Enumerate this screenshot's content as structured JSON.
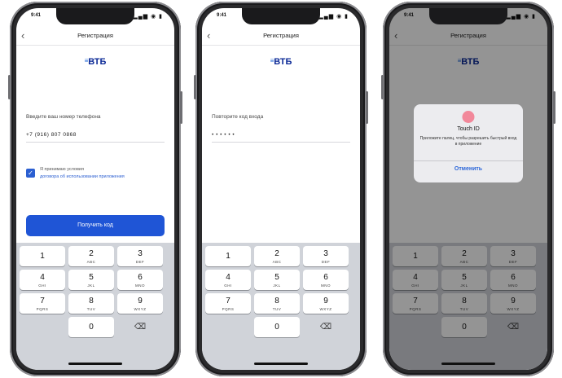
{
  "status_time": "9:41",
  "status_icons": "▂▄▆ ◉ ▮",
  "nav": {
    "back_icon": "‹",
    "title": "Регистрация"
  },
  "logo": {
    "stripes": "≡",
    "text": "ВТБ"
  },
  "phone1": {
    "label": "Введите ваш номер телефона",
    "phone_value": "+7 (916) 807 0868",
    "checkbox_mark": "✓",
    "agree_text": "Я принимаю условия",
    "agree_link": "договора об использовании приложения",
    "button_label": "Получить код"
  },
  "phone2": {
    "label": "Повторите код входа",
    "code_value": "• • • • • •"
  },
  "phone3": {
    "dialog_title": "Touch ID",
    "dialog_message": "Приложите палец, чтобы разрешить быстрый вход в приложение",
    "dialog_button": "Отменить"
  },
  "keypad": {
    "keys": [
      {
        "digit": "1",
        "letters": ""
      },
      {
        "digit": "2",
        "letters": "ABC"
      },
      {
        "digit": "3",
        "letters": "DEF"
      },
      {
        "digit": "4",
        "letters": "GHI"
      },
      {
        "digit": "5",
        "letters": "JKL"
      },
      {
        "digit": "6",
        "letters": "MNO"
      },
      {
        "digit": "7",
        "letters": "PQRS"
      },
      {
        "digit": "8",
        "letters": "TUV"
      },
      {
        "digit": "9",
        "letters": "WXYZ"
      },
      {
        "digit": "0",
        "letters": ""
      }
    ],
    "delete_icon": "⌫"
  },
  "colors": {
    "accent_blue": "#1f55d6",
    "brand_navy": "#0a2896",
    "touch_id_pink": "#f2889a"
  }
}
